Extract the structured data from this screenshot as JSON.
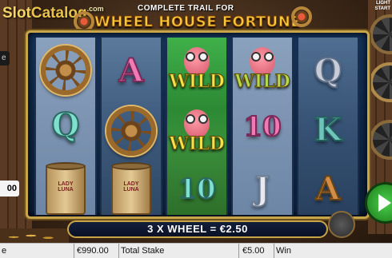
{
  "header": {
    "logo_slot": "Slot",
    "logo_catalog": "Catalog",
    "logo_com": ".com",
    "trail_title": "COMPLETE TRAIL FOR",
    "feature_name": "WHEEL HOUSE FORTUNE"
  },
  "side_panel": {
    "light_start_line1": "LIGHT",
    "light_start_line2": "START"
  },
  "left_stub": {
    "top_text": "e",
    "value_text": "00"
  },
  "reels": [
    {
      "symbols": [
        "ship-wheel",
        "Q",
        "lady-luna-can"
      ]
    },
    {
      "symbols": [
        "A",
        "ship-wheel",
        "lady-luna-can"
      ]
    },
    {
      "symbols": [
        "crab-wild",
        "crab-wild",
        "10"
      ]
    },
    {
      "symbols": [
        "crab-wild",
        "10",
        "J"
      ]
    },
    {
      "symbols": [
        "Q",
        "K",
        "A"
      ]
    }
  ],
  "symbol_text": {
    "wild": "WILD",
    "can_label": "LADY LUNA",
    "letter_A": "A",
    "letter_Q": "Q",
    "letter_K": "K",
    "letter_J": "J",
    "number_10": "10"
  },
  "win_banner": "3 X WHEEL = €2.50",
  "status_bar": {
    "left_text": "e",
    "balance": "€990.00",
    "total_stake_label": "Total Stake",
    "win_amount": "€5.00",
    "win_label": "Win"
  },
  "colors": {
    "frame_gold": "#c9a54a",
    "wild_reel_green": "#3fb04a",
    "banner_bg": "#141f3c",
    "spin_green": "#4cd04c"
  }
}
